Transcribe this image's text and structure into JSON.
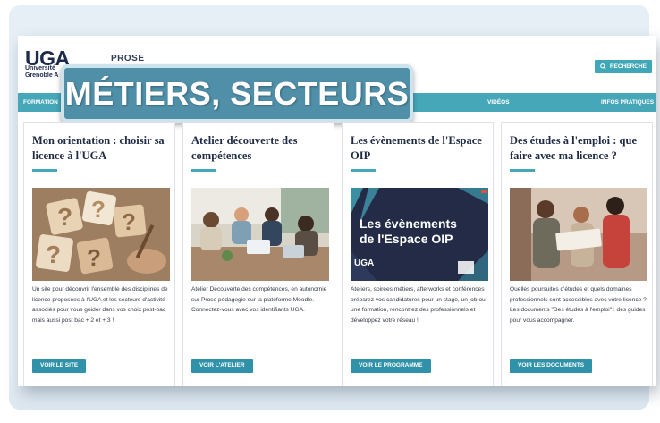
{
  "header": {
    "logo": "UGA",
    "logo_sub_1": "Université",
    "logo_sub_2": "Grenoble A",
    "site_name": "PROSE",
    "search_label": "RECHERCHE"
  },
  "banner": {
    "text": "MÉTIERS, SECTEURS"
  },
  "nav": {
    "formation": "FORMATION",
    "videos": "VIDÉOS",
    "infos": "INFOS PRATIQUES"
  },
  "cards": [
    {
      "title": "Mon orientation : choisir sa licence à l'UGA",
      "text": "Un site pour découvrir l'ensemble des disciplines de licence proposées à l'UGA et les secteurs d'activité associés pour vous guider dans vos choix post-bac mais aussi post bac + 2 et + 3 !",
      "button": "VOIR LE SITE"
    },
    {
      "title": "Atelier découverte des compétences",
      "text": "Atelier Découverte des compétences, en autonomie sur Prose pédagogie sur la plateforme Moodle.",
      "text2": "Connectez-vous avec vos identifiants UGA.",
      "button": "VOIR L'ATELIER"
    },
    {
      "title": "Les évènements de l'Espace OIP",
      "text": "Ateliers, soirées métiers, afterworks et conférences : préparez vos candidatures pour un stage, un job ou une formation, rencontrez des professionnels et développez votre réseau !",
      "button": "VOIR LE PROGRAMME",
      "image_line1": "Les évènements",
      "image_line2": "de l'Espace OIP",
      "image_logo": "UGA"
    },
    {
      "title": "Des études à l'emploi : que faire avec ma licence ?",
      "text": "Quelles poursuites d'études et quels domaines professionnels sont accessibles avec votre licence ?",
      "text2": "Les documents \"Des études à l'emploi\" : des guides pour vous accompagner.",
      "button": "VOIR LES DOCUMENTS"
    }
  ]
}
